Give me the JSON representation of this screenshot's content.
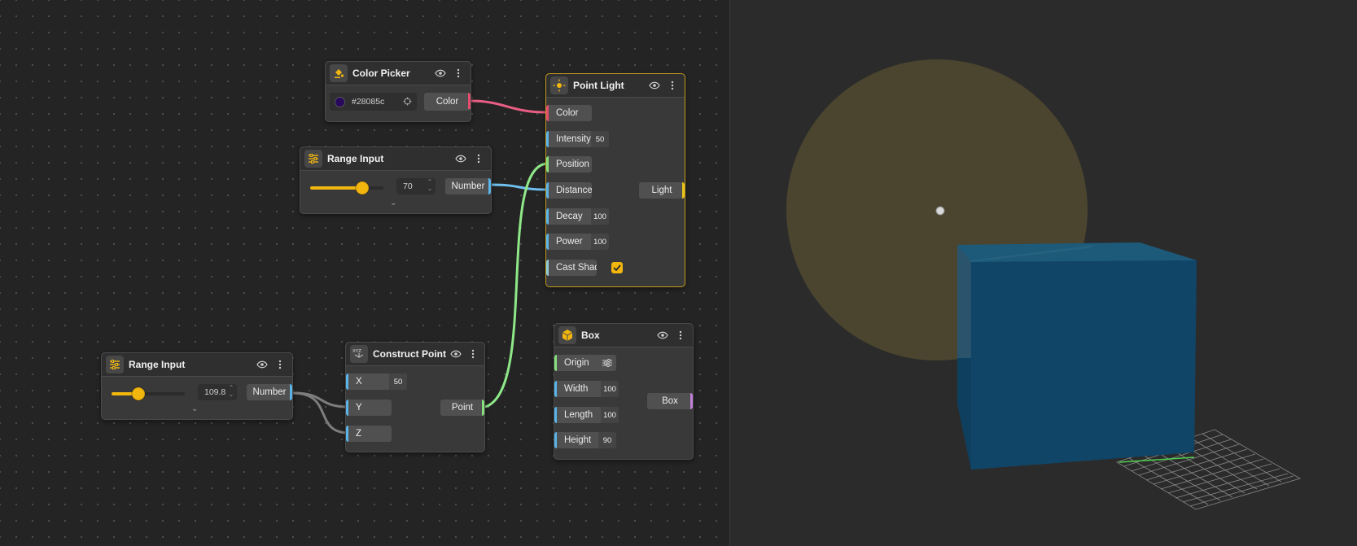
{
  "nodes": {
    "color_picker": {
      "title": "Color Picker",
      "hex": "#28085c",
      "output_label": "Color",
      "swatch": "#28085c",
      "icon": "paint-bucket-icon"
    },
    "range_input_top": {
      "title": "Range Input",
      "value": "70",
      "level": 0.7,
      "output_label": "Number",
      "icon": "sliders-icon"
    },
    "range_input_bottom": {
      "title": "Range Input",
      "value": "109.8",
      "level": 0.35,
      "output_label": "Number",
      "icon": "sliders-icon"
    },
    "construct_point": {
      "title": "Construct Point",
      "icon": "xyz-axis-icon",
      "inputs": {
        "x_label": "X",
        "x_value": "50",
        "y_label": "Y",
        "z_label": "Z"
      },
      "output_label": "Point"
    },
    "point_light": {
      "title": "Point Light",
      "icon": "light-bulb-icon",
      "inputs": {
        "color_label": "Color",
        "intensity_label": "Intensity",
        "intensity_value": "50",
        "position_label": "Position",
        "distance_label": "Distance",
        "decay_label": "Decay",
        "decay_value": "100",
        "power_label": "Power",
        "power_value": "100",
        "cast_shadow_label": "Cast Shad..."
      },
      "cast_shadow": true,
      "output_label": "Light"
    },
    "box": {
      "title": "Box",
      "icon": "cube-icon",
      "inputs": {
        "origin_label": "Origin",
        "width_label": "Width",
        "width_value": "100",
        "length_label": "Length",
        "length_value": "100",
        "height_label": "Height",
        "height_value": "90"
      },
      "output_label": "Box"
    }
  },
  "colors": {
    "accent": "#f2b70f",
    "color_port": "#e44d6e",
    "number_port": "#5ab4e8",
    "point_port": "#86e07e",
    "bool_port": "#8ecbd6",
    "light_port": "#e8c21a",
    "box_port": "#c07fd8",
    "wire_gray": "#7a7a7a",
    "light_sphere": "#4d472f",
    "box_face": "#174a6a"
  },
  "icons": {
    "visibility": "eye-icon",
    "menu": "kebab-menu-icon",
    "origin_settings": "sliders-small-icon",
    "check": "check-icon"
  }
}
